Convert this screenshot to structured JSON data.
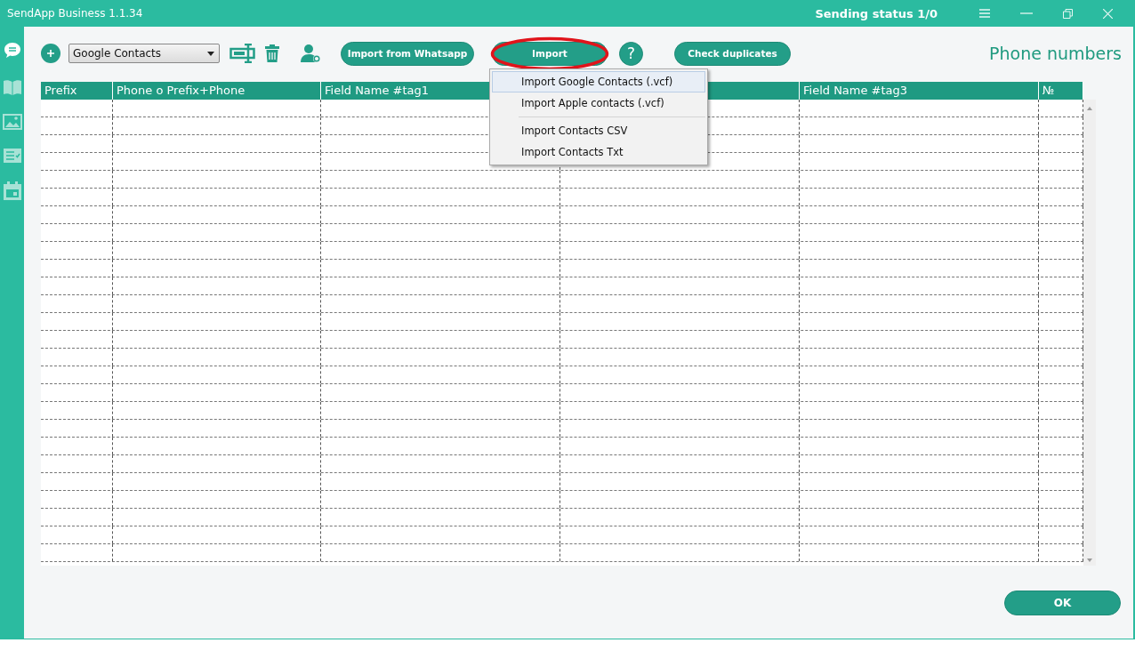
{
  "window": {
    "title": "SendApp Business 1.1.34",
    "status": "Sending status 1/0"
  },
  "sidebar": {
    "items": [
      {
        "kind": "chat",
        "selected": true
      },
      {
        "kind": "book",
        "selected": false
      },
      {
        "kind": "image",
        "selected": false
      },
      {
        "kind": "list",
        "selected": false
      },
      {
        "kind": "calendar",
        "selected": false
      }
    ]
  },
  "toolbar": {
    "source_select": {
      "value": "Google Contacts"
    },
    "buttons": [
      {
        "label": "Import from Whatsapp",
        "circled": false
      },
      {
        "label": "Import",
        "circled": true
      },
      {
        "label": "?",
        "circled": false
      },
      {
        "label": "Check duplicates",
        "circled": false
      }
    ],
    "heading": "Phone numbers"
  },
  "import_menu": {
    "groups": [
      {
        "items": [
          {
            "label": "Import Google Contacts (.vcf)",
            "selected": true
          },
          {
            "label": "Import Apple contacts (.vcf)",
            "selected": false
          }
        ]
      },
      {
        "items": [
          {
            "label": "Import Contacts CSV",
            "selected": false
          },
          {
            "label": "Import Contacts Txt",
            "selected": false
          }
        ]
      }
    ]
  },
  "table": {
    "columns": [
      {
        "label": "Prefix"
      },
      {
        "label": "Phone o Prefix+Phone"
      },
      {
        "label": "Field Name #tag1"
      },
      {
        "covered": true
      },
      {
        "label": "Field Name #tag3"
      },
      {
        "label": "№"
      }
    ]
  },
  "ok_button": "OK"
}
